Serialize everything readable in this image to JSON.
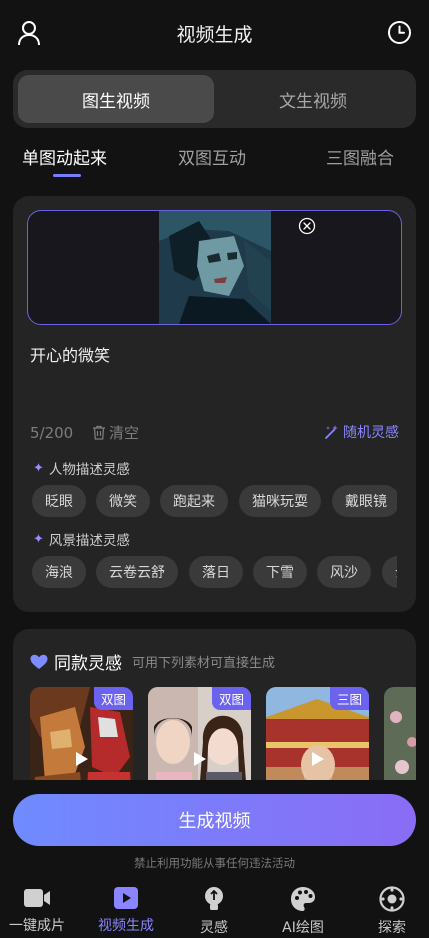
{
  "header": {
    "title": "视频生成",
    "user_icon": "user-icon",
    "history_icon": "clock-icon"
  },
  "mode_switch": {
    "active": "图生视频",
    "inactive": "文生视频"
  },
  "sub_tabs": {
    "items": [
      "单图动起来",
      "双图互动",
      "三图融合"
    ],
    "selected": "单图动起来",
    "accent": "#7b7bff"
  },
  "editor": {
    "prompt": "开心的微笑",
    "counter": "5/200",
    "clear_label": "清空",
    "random_label": "随机灵感",
    "upload_border_color": "#6a62e0"
  },
  "character_inspiration": {
    "label": "人物描述灵感",
    "chips": [
      "眨眼",
      "微笑",
      "跑起来",
      "猫咪玩耍",
      "戴眼镜"
    ]
  },
  "scenery_inspiration": {
    "label": "风景描述灵感",
    "chips": [
      "海浪",
      "云卷云舒",
      "落日",
      "下雪",
      "风沙",
      "云"
    ]
  },
  "same_style": {
    "title": "同款灵感",
    "subtitle": "可用下列素材可直接生成",
    "samples": [
      {
        "tag": "双图"
      },
      {
        "tag": "双图"
      },
      {
        "tag": "三图"
      },
      {
        "tag": ""
      }
    ]
  },
  "generate_button": "生成视频",
  "notice": "禁止利用功能从事任何违法活动",
  "tabbar": {
    "items": [
      {
        "label": "一键成片",
        "icon": "video-camera-icon"
      },
      {
        "label": "视频生成",
        "icon": "play-square-icon"
      },
      {
        "label": "灵感",
        "icon": "lightbulb-icon"
      },
      {
        "label": "AI绘图",
        "icon": "palette-icon"
      },
      {
        "label": "探索",
        "icon": "compass-icon"
      }
    ],
    "active": "视频生成",
    "active_color": "#8a86ff"
  }
}
